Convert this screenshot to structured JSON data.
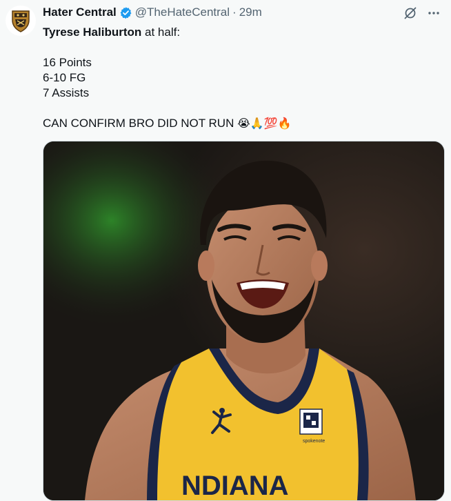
{
  "tweet": {
    "author_name": "Hater Central",
    "handle": "@TheHateCentral",
    "separator": "·",
    "time": "29m",
    "lines": {
      "player": "Tyrese Haliburton",
      "suffix": " at half:",
      "points": "16 Points",
      "fg": "6-10 FG",
      "assists": "7 Assists",
      "caption": "CAN CONFIRM BRO DID NOT RUN",
      "emojis": "😭🙏💯🔥"
    },
    "media": {
      "jersey_text": "NDIANA",
      "sponsor_text": "spokenote"
    }
  },
  "icons": {
    "verified": "verified-badge-icon",
    "grok": "grok-icon",
    "more": "more-icon",
    "logo": "shield-crest-icon",
    "jumpman": "jumpman-logo-icon"
  },
  "colors": {
    "verified_blue": "#1d9bf0",
    "jersey_yellow": "#f2c12e",
    "jersey_navy": "#1b2648",
    "secondary_text": "#536471"
  }
}
